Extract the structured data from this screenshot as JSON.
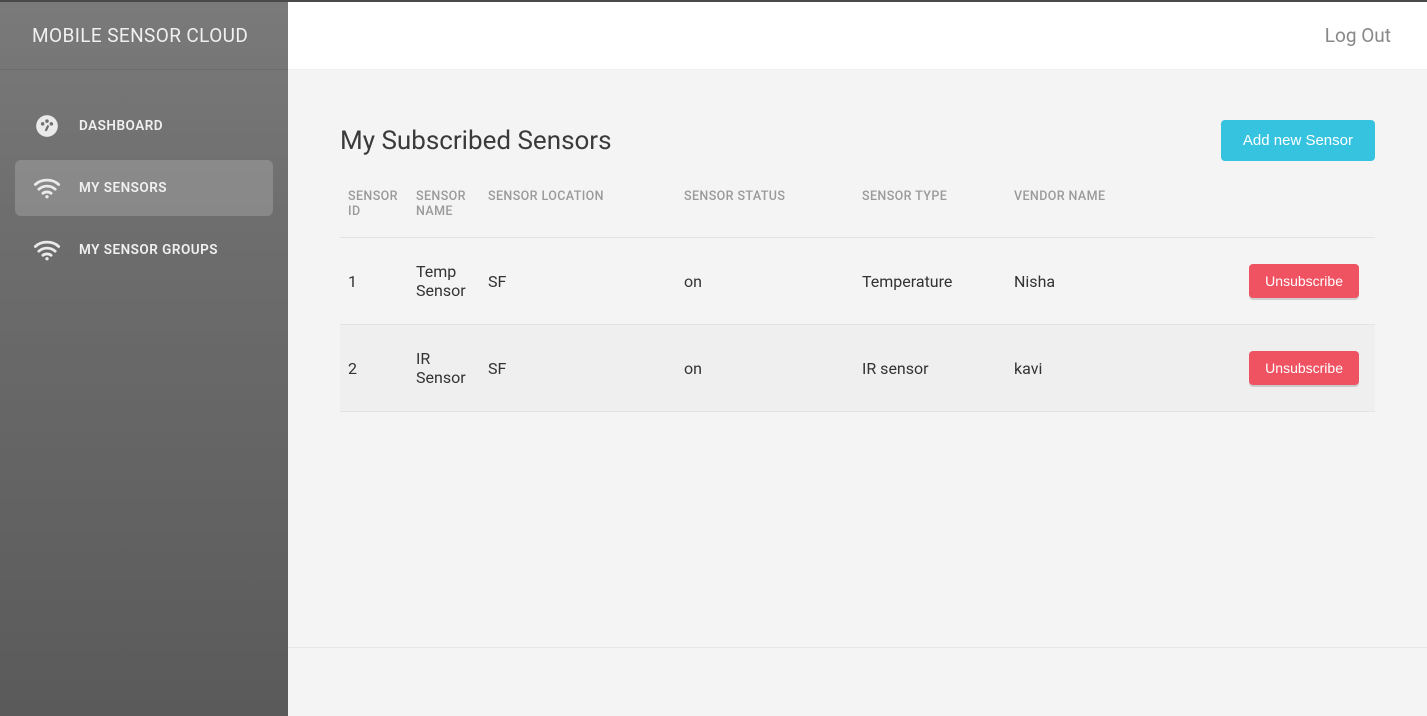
{
  "brand": "MOBILE SENSOR CLOUD",
  "nav": {
    "items": [
      {
        "label": "DASHBOARD",
        "icon": "dashboard",
        "active": false
      },
      {
        "label": "MY SENSORS",
        "icon": "wifi",
        "active": true
      },
      {
        "label": "MY SENSOR GROUPS",
        "icon": "wifi",
        "active": false
      }
    ]
  },
  "topbar": {
    "logout": "Log Out"
  },
  "page": {
    "title": "My Subscribed Sensors",
    "add_button": "Add new Sensor"
  },
  "table": {
    "columns": {
      "id": "SENSOR ID",
      "name": "SENSOR NAME",
      "location": "SENSOR LOCATION",
      "status": "SENSOR STATUS",
      "type": "SENSOR TYPE",
      "vendor": "VENDOR NAME"
    },
    "action_label": "Unsubscribe",
    "rows": [
      {
        "id": "1",
        "name": "Temp Sensor",
        "location": "SF",
        "status": "on",
        "type": "Temperature",
        "vendor": "Nisha"
      },
      {
        "id": "2",
        "name": "IR Sensor",
        "location": "SF",
        "status": "on",
        "type": "IR sensor",
        "vendor": "kavi"
      }
    ]
  },
  "colors": {
    "primary": "#35c3e0",
    "danger": "#ef5362",
    "sidebar": "#6e6e6e"
  }
}
